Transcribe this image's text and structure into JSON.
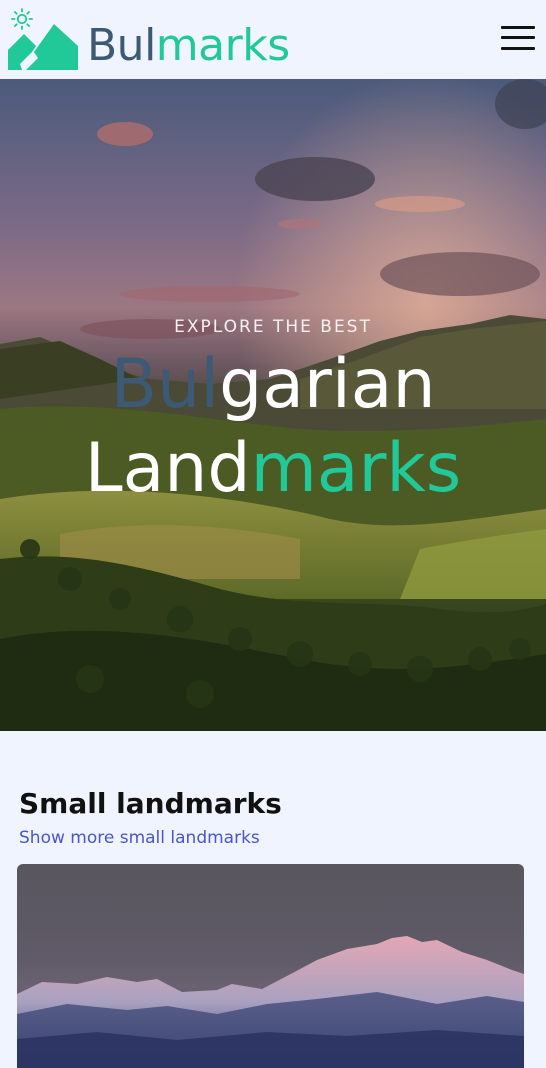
{
  "brand": {
    "name_part1": "Bul",
    "name_part2": "marks",
    "colors": {
      "dark": "#3c5a73",
      "green": "#20c997"
    }
  },
  "header": {
    "theme_icon": "sun-icon",
    "menu_icon": "hamburger-menu-icon"
  },
  "hero": {
    "eyebrow": "EXPLORE THE BEST",
    "line1_part1": "Bul",
    "line1_part2": "garian",
    "line2_part1": "Land",
    "line2_part2": "marks"
  },
  "section": {
    "title": "Small landmarks",
    "link": "Show more small landmarks"
  }
}
